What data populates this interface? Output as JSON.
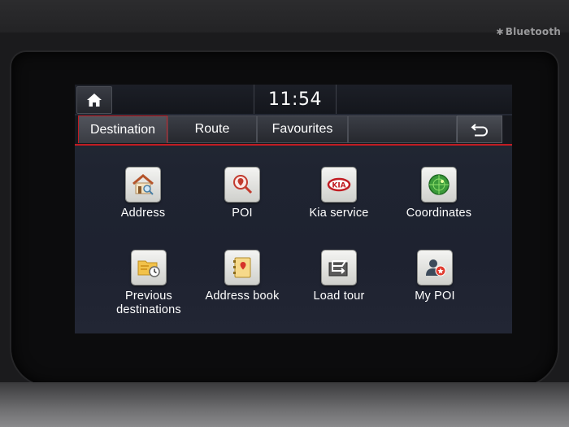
{
  "device": {
    "bluetooth_label": "Bluetooth"
  },
  "status_bar": {
    "time": "11:54"
  },
  "tabs": [
    {
      "label": "Destination",
      "active": true
    },
    {
      "label": "Route",
      "active": false
    },
    {
      "label": "Favourites",
      "active": false
    }
  ],
  "menu": {
    "row1": [
      {
        "label": "Address",
        "icon": "house-search-icon"
      },
      {
        "label": "POI",
        "icon": "map-pin-search-icon"
      },
      {
        "label": "Kia service",
        "icon": "kia-logo-icon"
      },
      {
        "label": "Coordinates",
        "icon": "radar-globe-icon"
      }
    ],
    "row2": [
      {
        "label_line1": "Previous",
        "label_line2": "destinations",
        "icon": "folder-clock-icon"
      },
      {
        "label": "Address book",
        "icon": "address-book-icon"
      },
      {
        "label": "Load tour",
        "icon": "route-folder-icon"
      },
      {
        "label": "My POI",
        "icon": "user-star-icon"
      }
    ]
  },
  "colors": {
    "accent": "#c11c22",
    "screen_bg": "#1f2431",
    "text": "#ffffff"
  }
}
